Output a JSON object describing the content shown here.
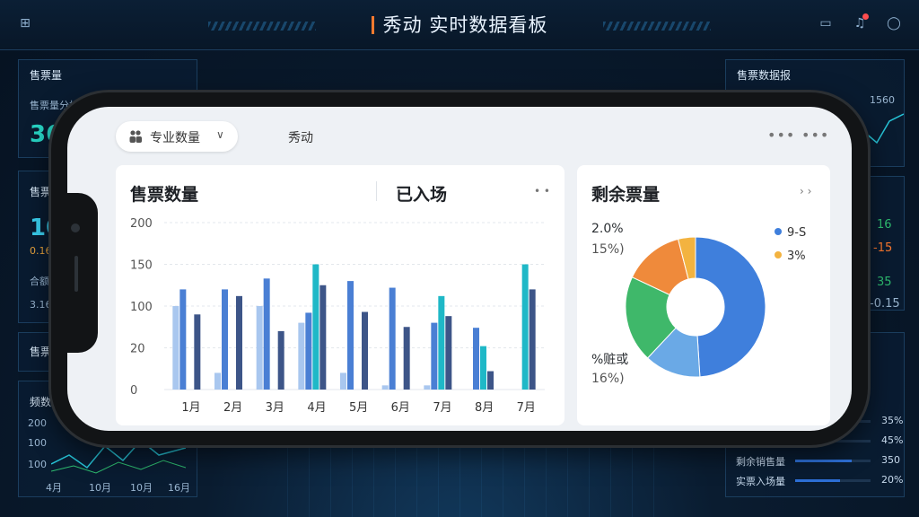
{
  "dashboard": {
    "title": "秀动  实时数据看板",
    "left_panels": [
      {
        "title": "售票量",
        "sub": "售票量分析",
        "big": "36"
      },
      {
        "title": "售票",
        "big": "10",
        "line1": "0.16",
        "line2": "合额",
        "line3": "3.16"
      },
      {
        "title": "售票"
      },
      {
        "title": "频数",
        "ticks": [
          "200",
          "100",
          "100"
        ],
        "months": [
          "4月",
          "10月",
          "10月",
          "16月"
        ]
      }
    ],
    "right_panels": [
      {
        "title": "售票数据报",
        "value": "1560"
      },
      {
        "side_values": [
          "16",
          "-15",
          "35",
          "-0.15"
        ]
      }
    ],
    "right_stats": [
      {
        "label": "",
        "pct": "35%",
        "color": "#2fbf71",
        "fill": 0.35
      },
      {
        "label": "",
        "pct": "45%",
        "color": "#2fbf71",
        "fill": 0.45
      },
      {
        "label": "剩余销售量",
        "pct": "350",
        "color": "#2d6fd6",
        "fill": 0.75
      },
      {
        "label": "实票入场量",
        "pct": "20%",
        "color": "#2d6fd6",
        "fill": 0.6
      }
    ]
  },
  "app": {
    "dropdown_label": "专业数量",
    "top_label": "秀动",
    "more_glyph": "•••"
  },
  "bar_card": {
    "title": "售票数量",
    "title2": "已入场",
    "more": "• •"
  },
  "pie_card": {
    "title": "剩余票量",
    "more": "› ›",
    "label_top_value": "2.0%",
    "label_top_pct": "15%)",
    "label_bottom_name": "%赃或",
    "label_bottom_pct": "16%)",
    "legend": [
      {
        "text": "9-S",
        "color": "#3f7fdc"
      },
      {
        "text": "3%",
        "color": "#f3b340"
      }
    ]
  },
  "colors": {
    "accent_orange": "#ff7a2f",
    "bar_light": "#a9c7ef",
    "bar_blue": "#4a7fd4",
    "bar_dark": "#3d5588",
    "bar_teal": "#1fb8c7",
    "bar_green": "#2fbf71"
  },
  "chart_data": [
    {
      "type": "bar",
      "title": "售票数量",
      "categories": [
        "1月",
        "2月",
        "3月",
        "4月",
        "5月",
        "6月",
        "7月",
        "8月",
        "7月"
      ],
      "ylim": [
        0,
        200
      ],
      "yticks": [
        "0",
        "20",
        "100",
        "150",
        "200"
      ],
      "series": [
        {
          "values": [
            100,
            20,
            100,
            80,
            20,
            5,
            5,
            0,
            0
          ],
          "color": "#a9c7ef"
        },
        {
          "values": [
            120,
            120,
            133,
            92,
            130,
            122,
            80,
            74,
            0
          ],
          "color": "#4a7fd4"
        },
        {
          "values": [
            0,
            0,
            0,
            150,
            0,
            0,
            112,
            52,
            150
          ],
          "color": "#1fb8c7"
        },
        {
          "values": [
            90,
            112,
            70,
            125,
            93,
            75,
            88,
            22,
            120
          ],
          "color": "#3d5588"
        }
      ]
    },
    {
      "type": "pie",
      "title": "剩余票量",
      "slices": [
        {
          "value": 49,
          "color": "#3f7fdc"
        },
        {
          "value": 13,
          "color": "#6aa9e6"
        },
        {
          "value": 20,
          "color": "#3fb86a"
        },
        {
          "value": 14,
          "color": "#ef8a3b"
        },
        {
          "value": 4,
          "color": "#f3b340"
        }
      ]
    }
  ]
}
